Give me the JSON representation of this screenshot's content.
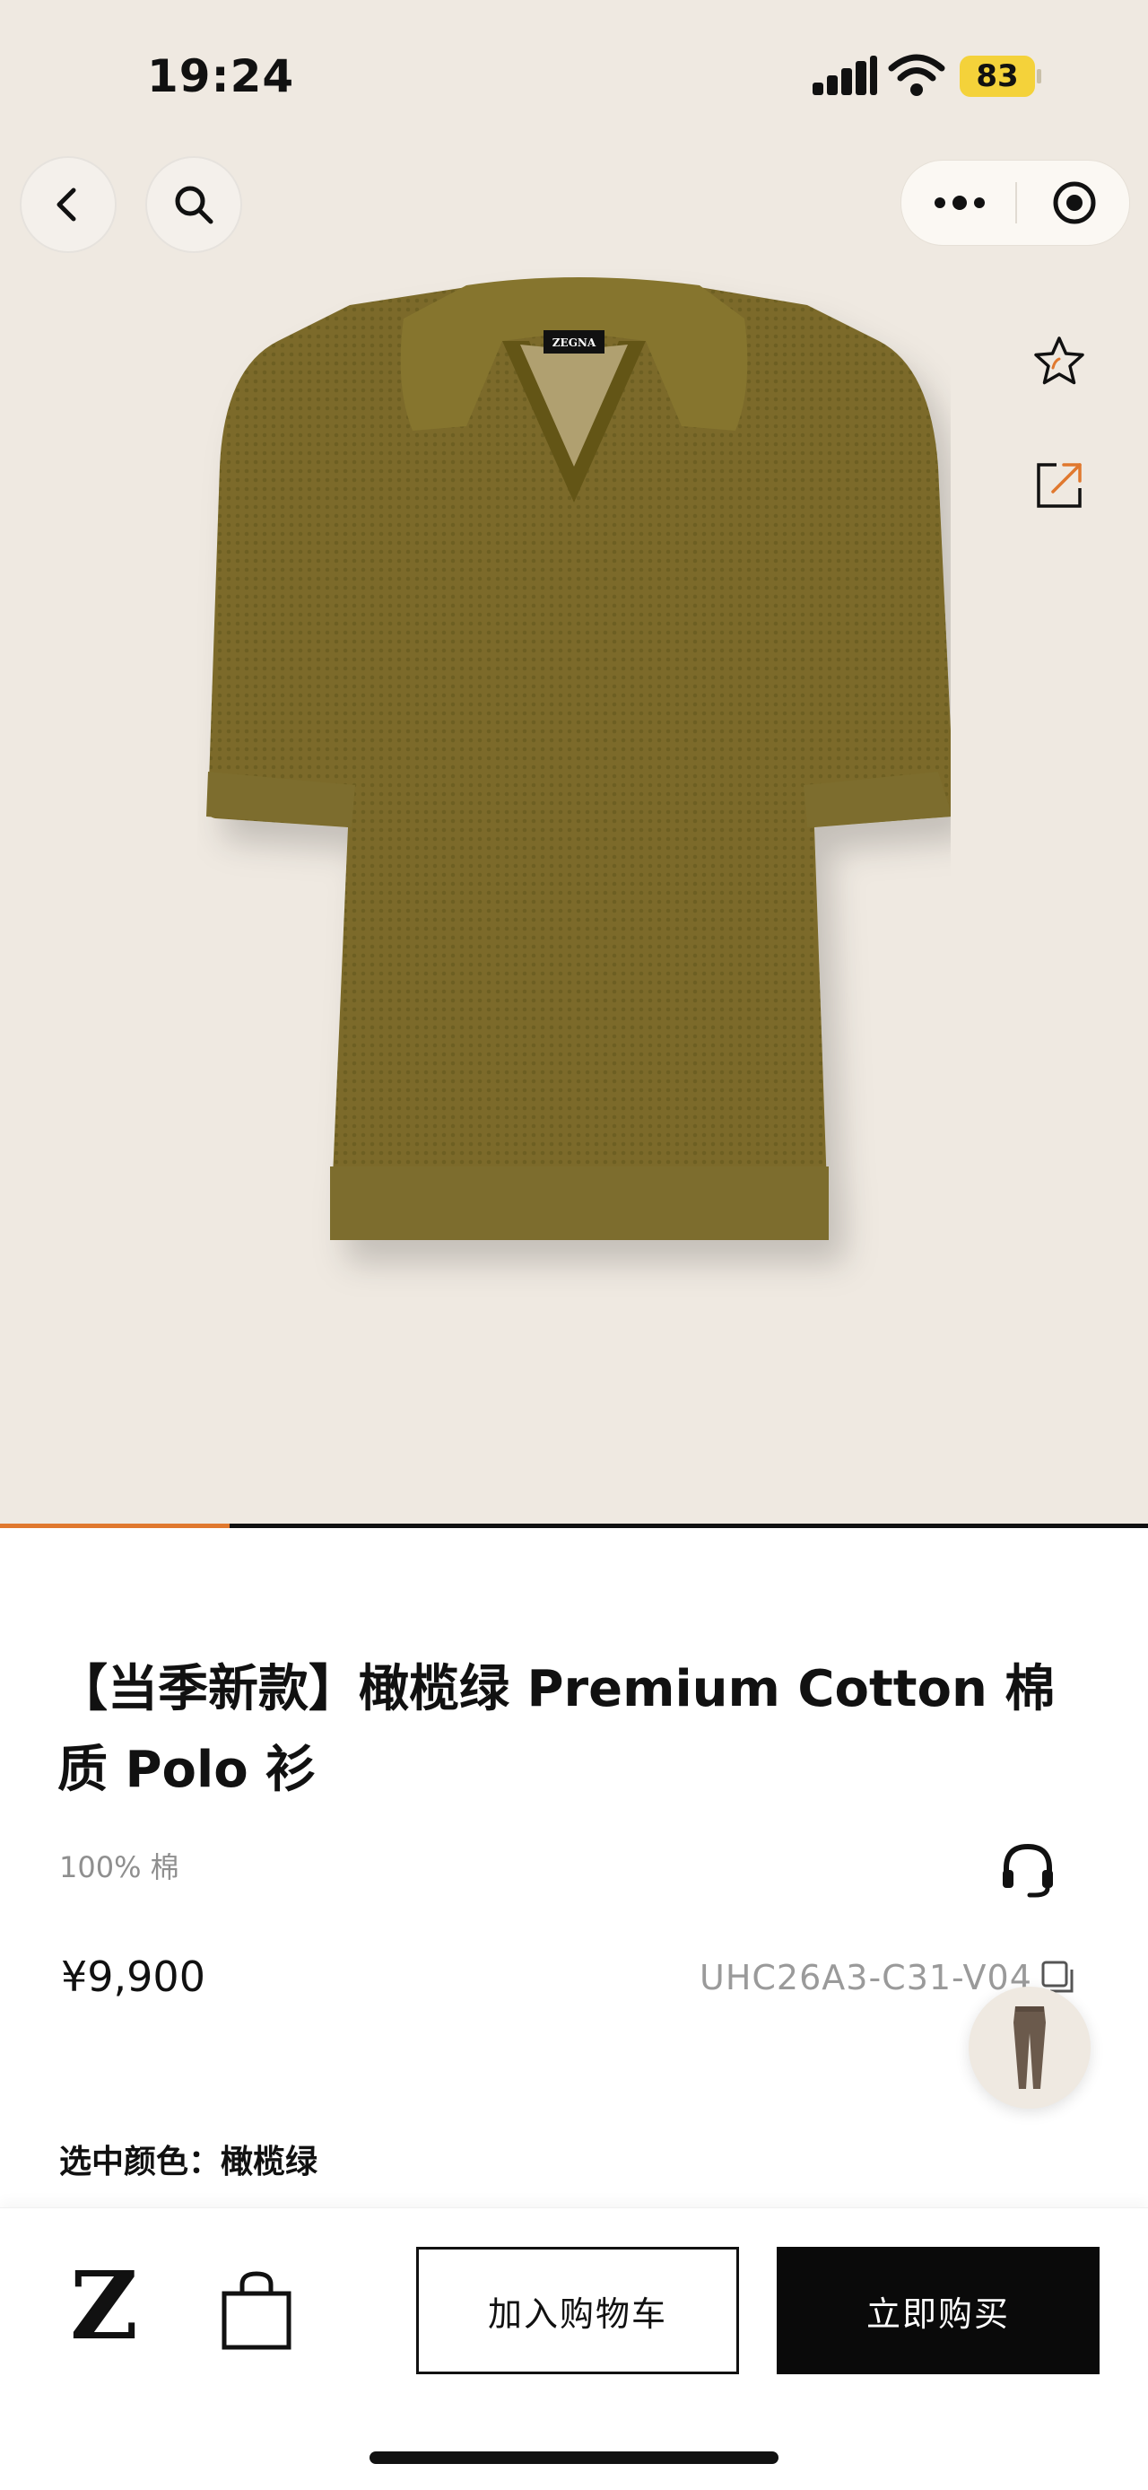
{
  "status_bar": {
    "time": "19:24",
    "battery": "83"
  },
  "nav": {
    "back_icon": "chevron-left-icon",
    "search_icon": "search-icon",
    "more_icon": "more-dots-icon",
    "target_icon": "target-icon"
  },
  "gallery": {
    "image": "olive polo shirt",
    "progress": 0.2,
    "favorite_icon": "star-icon",
    "share_icon": "share-icon"
  },
  "product": {
    "title": "【当季新款】橄榄绿 Premium Cotton 棉质 Polo 衫",
    "material": "100% 棉",
    "price": "¥9,900",
    "sku": "UHC26A3-C31-V04",
    "selected_color_label": "选中颜色：",
    "selected_color_value": "橄榄绿"
  },
  "bottom_bar": {
    "brand_logo": "Z",
    "add_to_cart": "加入购物车",
    "buy_now": "立即购买"
  },
  "colors": {
    "hero_bg": "#efe9e1",
    "accent": "#e0782e",
    "polo": "#7a6a2a",
    "battery": "#f4d23a"
  }
}
